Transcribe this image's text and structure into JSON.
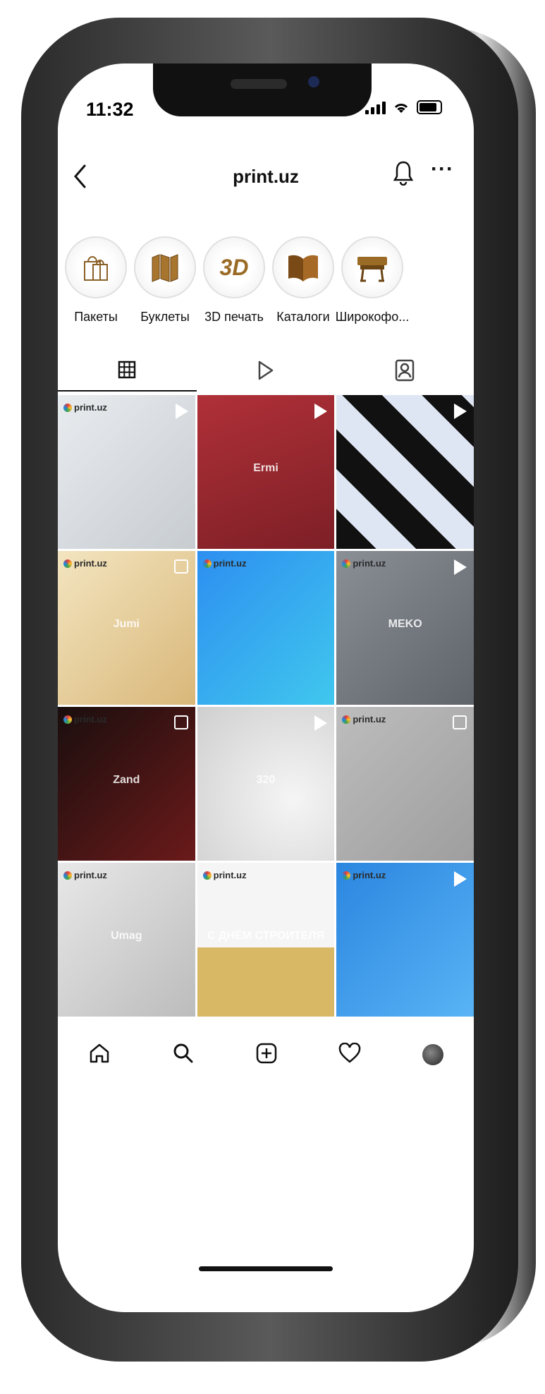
{
  "status_bar": {
    "time": "11:32"
  },
  "header": {
    "title": "print.uz",
    "back_icon": "chevron-left-icon",
    "bell_icon": "bell-icon",
    "more_label": "···"
  },
  "highlights": [
    {
      "label": "Пакеты",
      "icon": "shopping-bag-icon"
    },
    {
      "label": "Буклеты",
      "icon": "booklet-icon"
    },
    {
      "label": "3D печать",
      "icon": "3d-icon",
      "icon_text": "3D"
    },
    {
      "label": "Каталоги",
      "icon": "open-book-icon"
    },
    {
      "label": "Широкофо...",
      "icon": "plotter-icon"
    }
  ],
  "tabs": [
    {
      "name": "grid",
      "icon": "grid-icon"
    },
    {
      "name": "reels",
      "icon": "play-icon"
    },
    {
      "name": "tagged",
      "icon": "tagged-person-icon"
    }
  ],
  "posts": [
    {
      "logo": "print.uz",
      "badge": "play",
      "bg": "linear-gradient(135deg,#e9ecef,#c7ccd1)"
    },
    {
      "logo": "",
      "badge": "play",
      "bg": "linear-gradient(160deg,#b03038,#7d1f26)",
      "caption": "Ermi"
    },
    {
      "logo": "",
      "badge": "play",
      "bg": "repeating-linear-gradient(45deg,#111 0 40px,#dfe6f3 40px 80px)"
    },
    {
      "logo": "print.uz",
      "badge": "multi",
      "bg": "linear-gradient(135deg,#f3e5c0,#d9b779)",
      "caption": "Jumi"
    },
    {
      "logo": "print.uz",
      "badge": "",
      "bg": "linear-gradient(135deg,#2d8ff0,#40c7ee)"
    },
    {
      "logo": "print.uz",
      "badge": "play",
      "bg": "linear-gradient(135deg,#8a8f96,#5f646a)",
      "caption": "MEKO"
    },
    {
      "logo": "print.uz",
      "badge": "multi",
      "bg": "linear-gradient(135deg,#1a0e0e,#6b1a1a)",
      "caption": "Zand"
    },
    {
      "logo": "",
      "badge": "play",
      "bg": "radial-gradient(circle at 70% 60%,#f5f5f5,#cfcfcf)",
      "caption": "320"
    },
    {
      "logo": "print.uz",
      "badge": "multi",
      "bg": "linear-gradient(135deg,#bdbdbd,#9e9e9e)"
    },
    {
      "logo": "print.uz",
      "badge": "",
      "bg": "linear-gradient(135deg,#e8e8e8,#bcbcbc)",
      "caption": "Umag"
    },
    {
      "logo": "print.uz",
      "badge": "",
      "bg": "linear-gradient(180deg,#f5f5f5 0%,#f5f5f5 55%,#d9b865 55%)",
      "caption": "С ДНЁМ СТРОИТЕЛЯ"
    },
    {
      "logo": "print.uz",
      "badge": "play",
      "bg": "linear-gradient(135deg,#2b86e0,#59b3f5)"
    }
  ],
  "bottom_nav": [
    {
      "name": "home",
      "icon": "home-icon"
    },
    {
      "name": "search",
      "icon": "search-icon"
    },
    {
      "name": "new-post",
      "icon": "plus-square-icon"
    },
    {
      "name": "activity",
      "icon": "heart-icon"
    },
    {
      "name": "profile",
      "icon": "avatar-icon"
    }
  ],
  "colors": {
    "frame": "#2a2a2a",
    "steel": "#c9c9c9",
    "screen": "#ffffff",
    "text": "#111111"
  }
}
